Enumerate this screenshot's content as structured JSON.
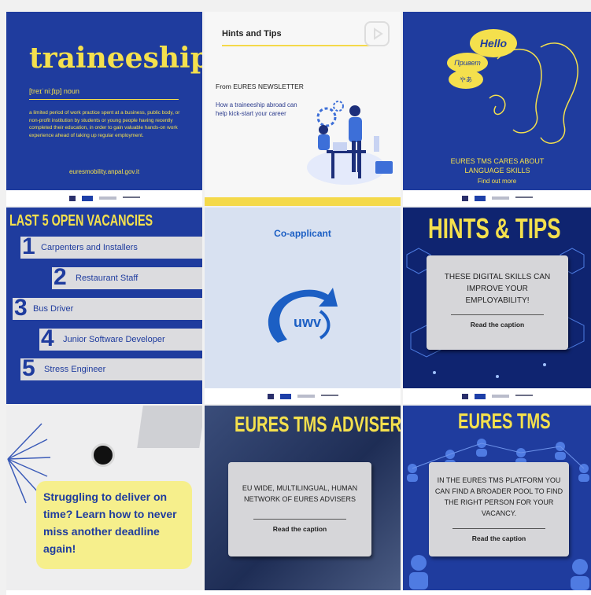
{
  "tile1": {
    "title": "traineeship",
    "phonetic": "[treɪˈniːʃɪp] noun",
    "definition": "a limited period of work practice spent at a business, public body, or non-profit institution by students or young people having recently completed their education, in order to gain valuable hands-on work experience ahead of taking up regular employment.",
    "url": "euresmobility.anpal.gov.it"
  },
  "tile2": {
    "title": "Hints and Tips",
    "source": "From EURES NEWSLETTER",
    "subtitle": "How a traineeship abroad can help kick-start your career"
  },
  "tile3": {
    "bubble_hello": "Hello",
    "bubble_privet": "Привет",
    "bubble_jp": "やあ",
    "heading": "EURES TMS CARES ABOUT LANGUAGE SKILLS",
    "link": "Find out more"
  },
  "tile4": {
    "title": "LAST 5 OPEN VACANCIES",
    "items": [
      {
        "num": "1",
        "label": "Carpenters and Installers"
      },
      {
        "num": "2",
        "label": "Restaurant Staff"
      },
      {
        "num": "3",
        "label": "Bus Driver"
      },
      {
        "num": "4",
        "label": "Junior Software Developer"
      },
      {
        "num": "5",
        "label": "Stress Engineer"
      }
    ]
  },
  "tile5": {
    "title": "Co-applicant",
    "logo_text": "uwv"
  },
  "tile6": {
    "title": "HINTS & TIPS",
    "card_text": "THESE DIGITAL SKILLS CAN IMPROVE YOUR EMPLOYABILITY!",
    "caption": "Read the caption"
  },
  "tile7": {
    "text": "Struggling to deliver on time? Learn how to never miss another deadline again!"
  },
  "tile8": {
    "title": "EURES TMS ADVISER",
    "card_text": "EU WIDE, MULTILINGUAL, HUMAN NETWORK OF EURES ADVISERS",
    "caption": "Read the caption"
  },
  "tile9": {
    "title": "EURES TMS",
    "card_text": "IN THE EURES TMS PLATFORM YOU CAN FIND A BROADER POOL TO FIND THE RIGHT PERSON FOR YOUR VACANCY.",
    "caption": "Read the caption"
  },
  "colors": {
    "navy": "#1f3c9e",
    "yellow": "#f4e04d",
    "grey_card": "#d6d6d9",
    "uwv_blue": "#1c5fc4"
  }
}
